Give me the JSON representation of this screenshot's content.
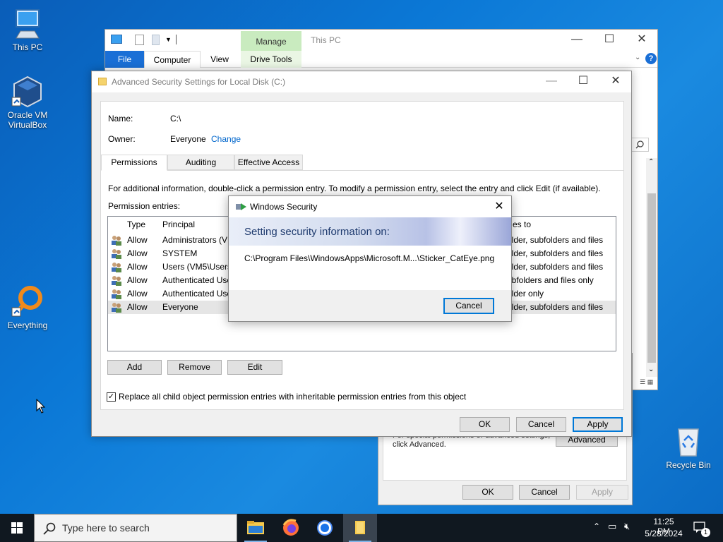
{
  "desktop": {
    "icons": [
      {
        "label": "This PC"
      },
      {
        "label": "Oracle VM VirtualBox"
      },
      {
        "label": "Everything"
      },
      {
        "label": "Recycle Bin"
      }
    ]
  },
  "explorer": {
    "title": "This PC",
    "context_tab": "Manage",
    "tabs": [
      "File",
      "Computer",
      "View",
      "Drive Tools"
    ],
    "help": "?"
  },
  "properties": {
    "hint_line1": "For special permissions or advanced settings,",
    "hint_line2": "click Advanced.",
    "advanced_label": "Advanced",
    "ok_label": "OK",
    "cancel_label": "Cancel",
    "apply_label": "Apply"
  },
  "advanced_dialog": {
    "title": "Advanced Security Settings for Local Disk (C:)",
    "name_label": "Name:",
    "name_value": "C:\\",
    "owner_label": "Owner:",
    "owner_value": "Everyone",
    "change_link": "Change",
    "tabs": [
      "Permissions",
      "Auditing",
      "Effective Access"
    ],
    "info_text": "For additional information, double-click a permission entry. To modify a permission entry, select the entry and click Edit (if available).",
    "entries_label": "Permission entries:",
    "columns": {
      "type": "Type",
      "principal": "Principal",
      "applies": "es to"
    },
    "entries": [
      {
        "type": "Allow",
        "principal": "Administrators (VM",
        "applies": "older, subfolders and files"
      },
      {
        "type": "Allow",
        "principal": "SYSTEM",
        "applies": "older, subfolders and files"
      },
      {
        "type": "Allow",
        "principal": "Users (VM5\\Users)",
        "applies": "older, subfolders and files"
      },
      {
        "type": "Allow",
        "principal": "Authenticated Use",
        "applies": "ubfolders and files only"
      },
      {
        "type": "Allow",
        "principal": "Authenticated Use",
        "applies": "older only"
      },
      {
        "type": "Allow",
        "principal": "Everyone",
        "applies": "older, subfolders and files"
      }
    ],
    "add_label": "Add",
    "remove_label": "Remove",
    "edit_label": "Edit",
    "replace_label": "Replace all child object permission entries with inheritable permission entries from this object",
    "ok_label": "OK",
    "cancel_label": "Cancel",
    "apply_label": "Apply"
  },
  "windows_security": {
    "title": "Windows Security",
    "heading": "Setting security information on:",
    "path": "C:\\Program Files\\WindowsApps\\Microsoft.M...\\Sticker_CatEye.png",
    "cancel_label": "Cancel"
  },
  "taskbar": {
    "search_placeholder": "Type here to search",
    "time": "11:25 PM",
    "date": "5/28/2024",
    "notification_count": "1"
  }
}
